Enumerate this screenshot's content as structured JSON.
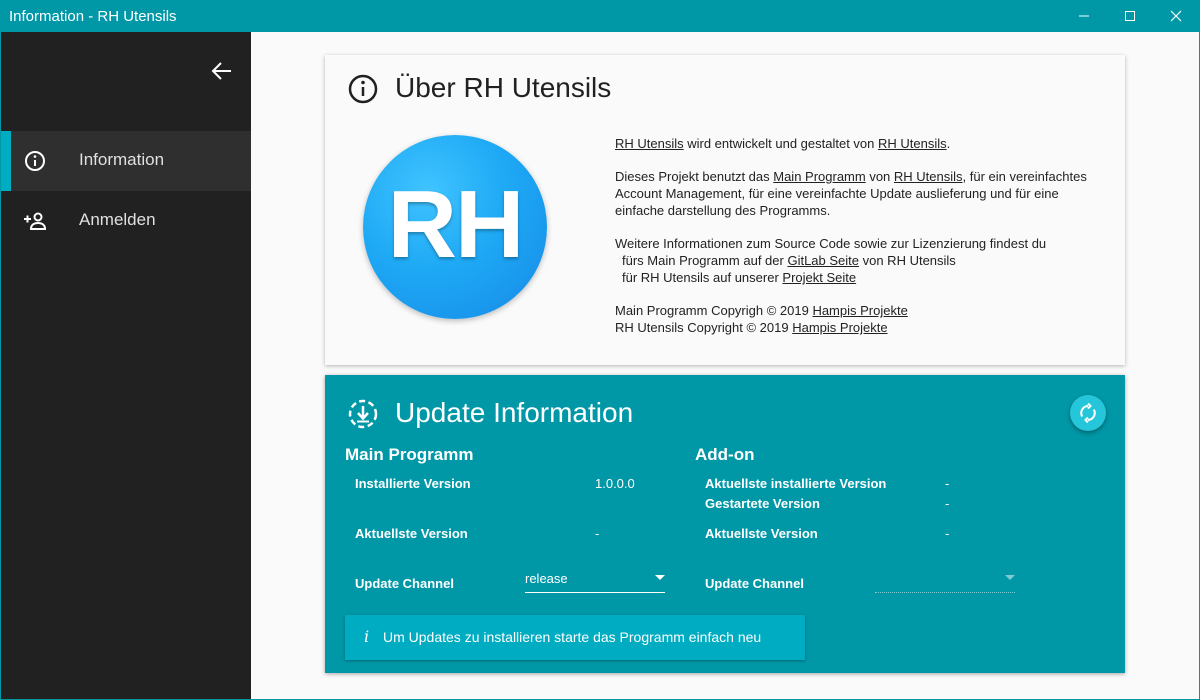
{
  "window": {
    "title": "Information - RH Utensils"
  },
  "sidebar": {
    "items": [
      {
        "label": "Information",
        "icon": "info-icon",
        "active": true
      },
      {
        "label": "Anmelden",
        "icon": "person-add-icon",
        "active": false
      }
    ]
  },
  "about": {
    "title": "Über RH Utensils",
    "logo_text": "RH",
    "p1": {
      "link1": "RH Utensils",
      "mid": " wird entwickelt und gestaltet von ",
      "link2": "RH Utensils",
      "end": "."
    },
    "p2": {
      "pre": "Dieses Projekt benutzt das ",
      "link1": "Main Programm",
      "mid": " von ",
      "link2": "RH Utensils",
      "end": ", für ein vereinfachtes Account Management, für eine vereinfachte Update auslieferung und für eine einfache darstellung des Programms."
    },
    "p3": {
      "line1": "Weitere Informationen zum Source Code sowie zur Lizenzierung findest du",
      "line2_pre": "fürs Main Programm auf der ",
      "line2_link": "GitLab Seite",
      "line2_end": " von RH Utensils",
      "line3_pre": "für RH Utensils auf unserer ",
      "line3_link": "Projekt Seite"
    },
    "copy1": {
      "pre": "Main Programm Copyrigh © 2019 ",
      "link": "Hampis Projekte"
    },
    "copy2": {
      "pre": "RH Utensils Copyright © 2019 ",
      "link": "Hampis Projekte"
    }
  },
  "update": {
    "title": "Update Information",
    "main": {
      "heading": "Main Programm",
      "installed_label": "Installierte Version",
      "installed_value": "1.0.0.0",
      "latest_label": "Aktuellste Version",
      "latest_value": "-",
      "channel_label": "Update Channel",
      "channel_value": "release"
    },
    "addon": {
      "heading": "Add-on",
      "installed_label": "Aktuellste installierte Version",
      "installed_value": "-",
      "started_label": "Gestartete Version",
      "started_value": "-",
      "latest_label": "Aktuellste Version",
      "latest_value": "-",
      "channel_label": "Update Channel",
      "channel_value": ""
    },
    "info_icon": "i",
    "info_text": "Um Updates zu installieren starte das Programm einfach neu"
  },
  "colors": {
    "accent": "#0097a7",
    "accent_light": "#00acc1",
    "sidebar_bg": "#212121"
  }
}
